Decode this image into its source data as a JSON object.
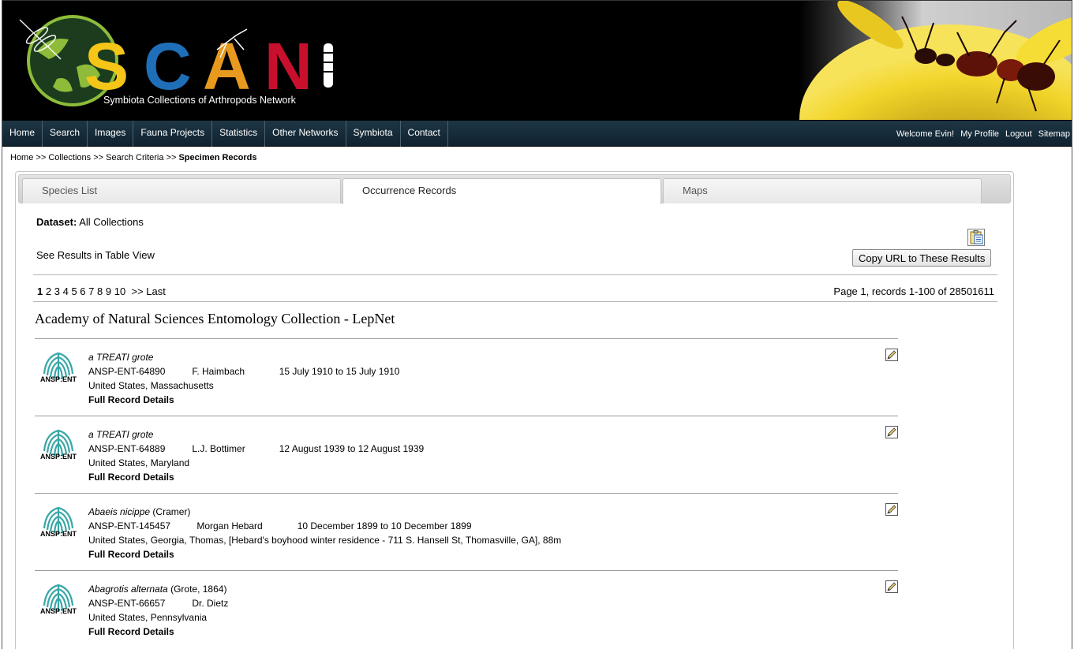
{
  "header": {
    "logo_text": "SCAN",
    "logo_subtitle": "Symbiota Collections of Arthropods Network"
  },
  "nav": {
    "items": [
      {
        "label": "Home"
      },
      {
        "label": "Search"
      },
      {
        "label": "Images"
      },
      {
        "label": "Fauna Projects"
      },
      {
        "label": "Statistics"
      },
      {
        "label": "Other Networks"
      },
      {
        "label": "Symbiota"
      },
      {
        "label": "Contact"
      }
    ],
    "welcome": "Welcome Evin!",
    "my_profile": "My Profile",
    "logout": "Logout",
    "sitemap": "Sitemap"
  },
  "breadcrumb": {
    "home": "Home",
    "sep": ">>",
    "collections": "Collections",
    "search_criteria": "Search Criteria",
    "current": "Specimen Records"
  },
  "tabs": [
    {
      "label": "Species List",
      "active": false
    },
    {
      "label": "Occurrence Records",
      "active": true
    },
    {
      "label": "Maps",
      "active": false
    }
  ],
  "dataset": {
    "label": "Dataset:",
    "value": "All Collections"
  },
  "table_view_link": "See Results in Table View",
  "copy_url_button": "Copy URL to These Results",
  "pager": {
    "pages": [
      "1",
      "2",
      "3",
      "4",
      "5",
      "6",
      "7",
      "8",
      "9",
      "10"
    ],
    "current": "1",
    "next": ">>",
    "last": "Last",
    "info": "Page 1, records 1-100 of 28501611"
  },
  "collection_title": "Academy of Natural Sciences Entomology Collection - LepNet",
  "records": [
    {
      "logo_label": "ANSP:ENT",
      "sci_name": "a TREATI grote",
      "author": "",
      "catalog": "ANSP-ENT-64890",
      "collector": "F. Haimbach",
      "date": "15 July 1910 to 15 July 1910",
      "locality": "United States, Massachusetts",
      "full_record": "Full Record Details"
    },
    {
      "logo_label": "ANSP:ENT",
      "sci_name": "a TREATI grote",
      "author": "",
      "catalog": "ANSP-ENT-64889",
      "collector": "L.J. Bottimer",
      "date": "12 August 1939 to 12 August 1939",
      "locality": "United States, Maryland",
      "full_record": "Full Record Details"
    },
    {
      "logo_label": "ANSP:ENT",
      "sci_name": "Abaeis nicippe",
      "author": "(Cramer)",
      "catalog": "ANSP-ENT-145457",
      "collector": "Morgan Hebard",
      "date": "10 December 1899 to 10 December 1899",
      "locality": "United States, Georgia, Thomas, [Hebard's boyhood winter residence - 711 S. Hansell St, Thomasville, GA], 88m",
      "full_record": "Full Record Details"
    },
    {
      "logo_label": "ANSP:ENT",
      "sci_name": "Abagrotis alternata",
      "author": "(Grote, 1864)",
      "catalog": "ANSP-ENT-66657",
      "collector": "Dr. Dietz",
      "date": "",
      "locality": "United States, Pennsylvania",
      "full_record": "Full Record Details"
    }
  ],
  "colors": {
    "nav_bg": "#1e3644",
    "logo_s": "#f5c518",
    "logo_c": "#1f6fb8",
    "logo_a": "#e89a1e",
    "logo_n": "#c8102e",
    "ansp_teal": "#3aa6a6"
  }
}
